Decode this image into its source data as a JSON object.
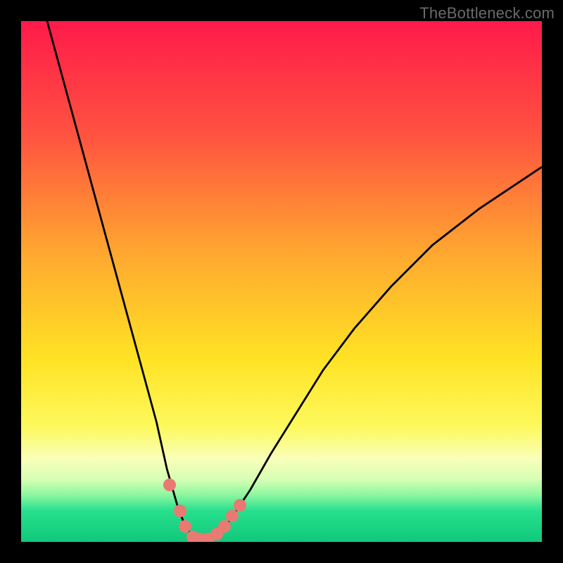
{
  "watermark": "TheBottleneck.com",
  "chart_data": {
    "type": "line",
    "title": "",
    "xlabel": "",
    "ylabel": "",
    "xlim": [
      0,
      100
    ],
    "ylim": [
      0,
      100
    ],
    "grid": false,
    "gradient_stops": [
      {
        "offset": 0,
        "color": "#ff1a4a"
      },
      {
        "offset": 22,
        "color": "#ff5340"
      },
      {
        "offset": 45,
        "color": "#ffa92f"
      },
      {
        "offset": 65,
        "color": "#ffe324"
      },
      {
        "offset": 78,
        "color": "#fdf95e"
      },
      {
        "offset": 84,
        "color": "#f9ffb9"
      },
      {
        "offset": 88,
        "color": "#d6ffb4"
      },
      {
        "offset": 91,
        "color": "#8cf6a0"
      },
      {
        "offset": 94,
        "color": "#27e08e"
      },
      {
        "offset": 100,
        "color": "#10c87a"
      }
    ],
    "series": [
      {
        "name": "bottleneck-curve",
        "x": [
          5,
          8,
          11,
          14,
          17,
          20,
          23,
          26,
          28,
          30,
          31.5,
          33,
          34,
          35,
          36,
          37,
          40,
          44,
          48,
          53,
          58,
          64,
          71,
          79,
          88,
          100
        ],
        "y": [
          100,
          89,
          78,
          67,
          56,
          45,
          34,
          23,
          14,
          7,
          3,
          1,
          0,
          0,
          0,
          1,
          4,
          10,
          17,
          25,
          33,
          41,
          49,
          57,
          64,
          72
        ]
      }
    ],
    "markers": {
      "color": "#e97a73",
      "points": [
        {
          "x": 28.5,
          "y": 11
        },
        {
          "x": 30.5,
          "y": 6
        },
        {
          "x": 31.5,
          "y": 3
        },
        {
          "x": 33.0,
          "y": 1
        },
        {
          "x": 34.5,
          "y": 0.5
        },
        {
          "x": 36.0,
          "y": 0.5
        },
        {
          "x": 37.5,
          "y": 1.5
        },
        {
          "x": 39.0,
          "y": 3
        },
        {
          "x": 40.5,
          "y": 5
        },
        {
          "x": 42.0,
          "y": 7
        }
      ]
    }
  }
}
